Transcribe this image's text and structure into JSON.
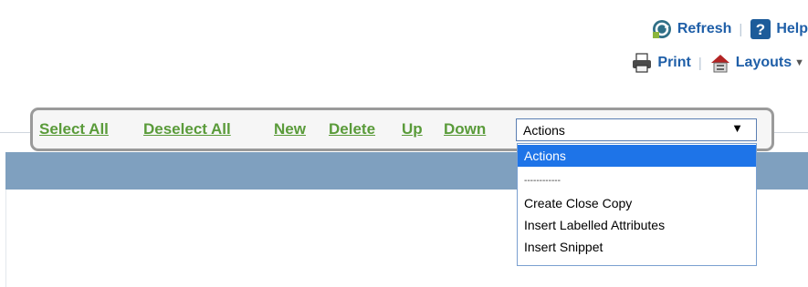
{
  "header": {
    "refresh_label": "Refresh",
    "help_label": "Help",
    "print_label": "Print",
    "layouts_label": "Layouts",
    "separator": "|",
    "icons": [
      "refresh-icon",
      "help-icon",
      "print-icon",
      "layouts-icon"
    ]
  },
  "toolbar": {
    "select_all": "Select All",
    "deselect_all": "Deselect All",
    "new": "New",
    "delete": "Delete",
    "up": "Up",
    "down": "Down"
  },
  "actions": {
    "selected": "Actions",
    "arrow": "▼",
    "options": [
      "Actions",
      "------------",
      "Create Close Copy",
      "Insert Labelled Attributes",
      "Insert Snippet"
    ]
  },
  "colors": {
    "toolbar_link": "#5a9b3a",
    "header_link": "#1f5fa8",
    "panel_bar": "#7fa0bf",
    "option_highlight": "#1e74e8"
  }
}
